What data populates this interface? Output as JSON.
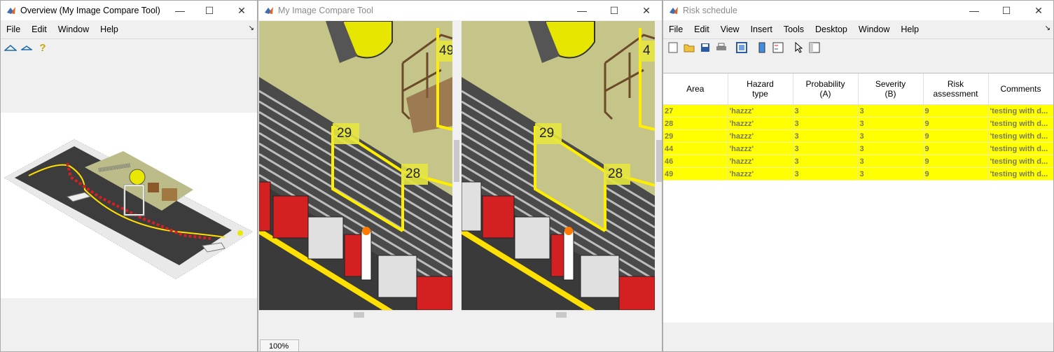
{
  "overview": {
    "title": "Overview (My Image Compare Tool)",
    "menu": [
      "File",
      "Edit",
      "Window",
      "Help"
    ],
    "tools": [
      "zoom-in-icon",
      "zoom-out-icon",
      "help-icon"
    ]
  },
  "compare": {
    "title": "My Image Compare Tool",
    "labels_left": [
      "29",
      "28",
      "49"
    ],
    "labels_right": [
      "29",
      "28",
      "4"
    ],
    "zoom": "100%"
  },
  "risk": {
    "title": "Risk schedule",
    "menu": [
      "File",
      "Edit",
      "View",
      "Insert",
      "Tools",
      "Desktop",
      "Window",
      "Help"
    ],
    "columns": [
      {
        "line1": "Area",
        "line2": ""
      },
      {
        "line1": "Hazard",
        "line2": "type"
      },
      {
        "line1": "Probability",
        "line2": "(A)"
      },
      {
        "line1": "Severity",
        "line2": "(B)"
      },
      {
        "line1": "Risk",
        "line2": "assessment"
      },
      {
        "line1": "Comments",
        "line2": ""
      }
    ],
    "rows": [
      {
        "area": "27",
        "hazard": "'hazzz'",
        "prob": "3",
        "sev": "3",
        "risk": "9",
        "comments": "'testing with d..."
      },
      {
        "area": "28",
        "hazard": "'hazzz'",
        "prob": "3",
        "sev": "3",
        "risk": "9",
        "comments": "'testing with d..."
      },
      {
        "area": "29",
        "hazard": "'hazzz'",
        "prob": "3",
        "sev": "3",
        "risk": "9",
        "comments": "'testing with d..."
      },
      {
        "area": "44",
        "hazard": "'hazzz'",
        "prob": "3",
        "sev": "3",
        "risk": "9",
        "comments": "'testing with d..."
      },
      {
        "area": "46",
        "hazard": "'hazzz'",
        "prob": "3",
        "sev": "3",
        "risk": "9",
        "comments": "'testing with d..."
      },
      {
        "area": "49",
        "hazard": "'hazzz'",
        "prob": "3",
        "sev": "3",
        "risk": "9",
        "comments": "'testing with d..."
      }
    ]
  },
  "colors": {
    "highlight": "#ffff00",
    "fence": "#ffee00",
    "barrier_red": "#d42020",
    "ground": "#c9c98a",
    "road": "#3a3a3a"
  }
}
